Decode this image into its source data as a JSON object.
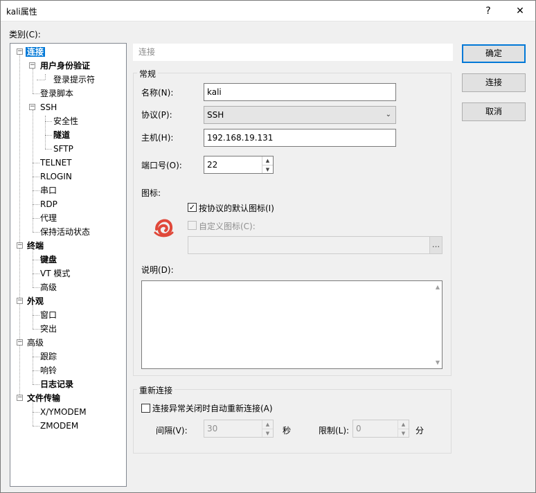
{
  "window": {
    "title": "kali属性",
    "help_glyph": "?",
    "close_glyph": "✕"
  },
  "category_label": "类别(C):",
  "tree": {
    "connection": "连接",
    "user_auth": "用户身份验证",
    "login_prompt": "登录提示符",
    "login_script": "登录脚本",
    "ssh": "SSH",
    "security": "安全性",
    "tunnel": "隧道",
    "sftp": "SFTP",
    "telnet": "TELNET",
    "rlogin": "RLOGIN",
    "serial": "串口",
    "rdp": "RDP",
    "proxy": "代理",
    "keepalive": "保持活动状态",
    "terminal": "终端",
    "keyboard": "键盘",
    "vt_mode": "VT 模式",
    "advanced": "高级",
    "appearance": "外观",
    "window": "窗口",
    "highlight": "突出",
    "advanced2": "高级",
    "trace": "跟踪",
    "bell": "响铃",
    "logging": "日志记录",
    "file_transfer": "文件传输",
    "xymodem": "X/YMODEM",
    "zmodem": "ZMODEM"
  },
  "panel": {
    "header": "连接",
    "general_group": "常规",
    "name_label": "名称(N):",
    "name_value": "kali",
    "protocol_label": "协议(P):",
    "protocol_value": "SSH",
    "host_label": "主机(H):",
    "host_value": "192.168.19.131",
    "port_label": "端口号(O):",
    "port_value": "22",
    "icon_label": "图标:",
    "default_icon_label": "按协议的默认图标(I)",
    "default_icon_checked": "✓",
    "custom_icon_label": "自定义图标(C):",
    "custom_icon_path": "",
    "browse_label": "...",
    "desc_label": "说明(D):",
    "desc_value": "",
    "reconnect_group": "重新连接",
    "reconnect_checkbox": "连接异常关闭时自动重新连接(A)",
    "interval_label": "间隔(V):",
    "interval_value": "30",
    "seconds_unit": "秒",
    "limit_label": "限制(L):",
    "limit_value": "0",
    "minutes_unit": "分"
  },
  "buttons": {
    "ok": "确定",
    "connect": "连接",
    "cancel": "取消"
  },
  "colors": {
    "selection": "#0078d7",
    "icon": "#e0483a"
  }
}
